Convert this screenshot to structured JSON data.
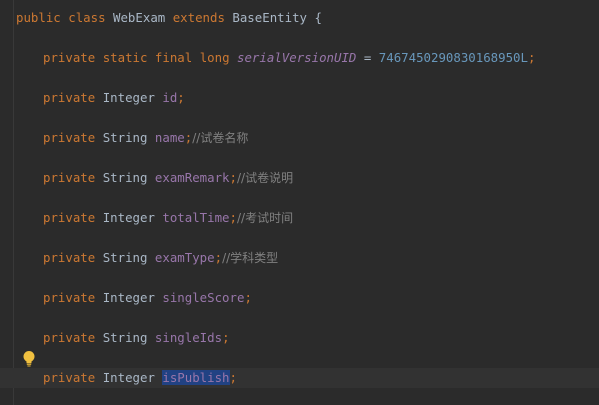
{
  "lines": {
    "class_decl": {
      "kw1": "public",
      "kw2": "class",
      "class_name": "WebExam",
      "kw3": "extends",
      "parent": "BaseEntity",
      "brace": "{"
    },
    "serial": {
      "kw1": "private",
      "kw2": "static",
      "kw3": "final",
      "kw4": "long",
      "name": "serialVersionUID",
      "eq": "=",
      "value": "7467450290830168950L",
      "semi": ";"
    },
    "fields": [
      {
        "kw": "private",
        "type": "Integer",
        "name": "id",
        "semi": ";",
        "comment": ""
      },
      {
        "kw": "private",
        "type": "String",
        "name": "name",
        "semi": ";",
        "comment": "//试卷名称"
      },
      {
        "kw": "private",
        "type": "String",
        "name": "examRemark",
        "semi": ";",
        "comment": "//试卷说明"
      },
      {
        "kw": "private",
        "type": "Integer",
        "name": "totalTime",
        "semi": ";",
        "comment": "//考试时间"
      },
      {
        "kw": "private",
        "type": "String",
        "name": "examType",
        "semi": ";",
        "comment": "//学科类型"
      },
      {
        "kw": "private",
        "type": "Integer",
        "name": "singleScore",
        "semi": ";",
        "comment": ""
      },
      {
        "kw": "private",
        "type": "String",
        "name": "singleIds",
        "semi": ";",
        "comment": ""
      },
      {
        "kw": "private",
        "type": "Integer",
        "name": "isPublish",
        "semi": ";",
        "comment": ""
      }
    ]
  },
  "colors": {
    "background": "#2b2b2b",
    "keyword": "#cc7832",
    "field": "#9876aa",
    "number": "#6897bb",
    "comment": "#808080",
    "default_text": "#a9b7c6",
    "current_line": "#323232",
    "selection": "#214283",
    "bulb": "#f0c040"
  },
  "icons": {
    "gutter": "lightbulb-icon"
  }
}
